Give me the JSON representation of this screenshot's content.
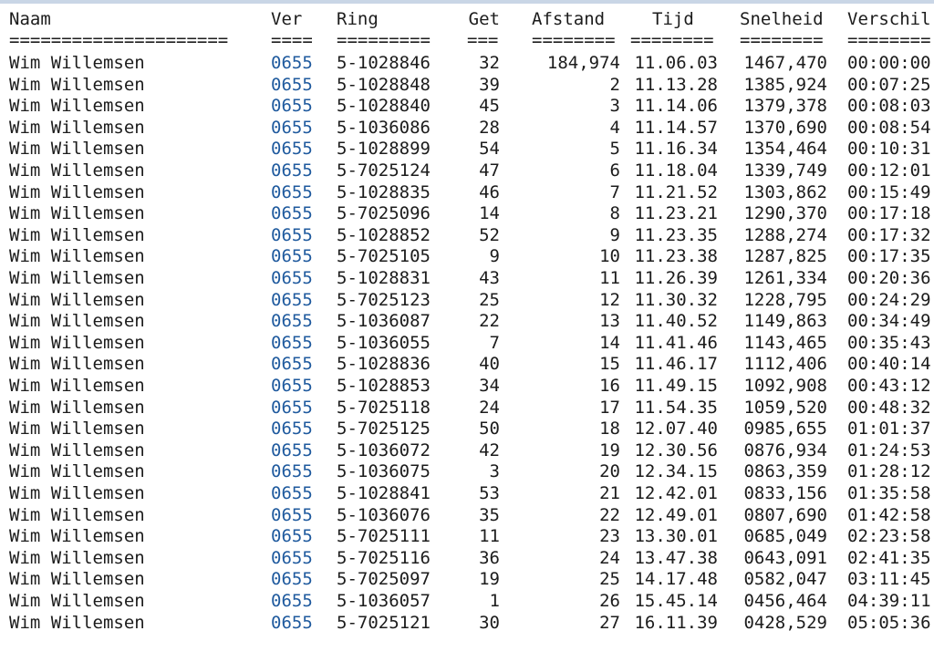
{
  "colors": {
    "text": "#1c1c1c",
    "link": "#1f5a9e",
    "background": "#ffffff"
  },
  "headers": {
    "naam": "Naam",
    "ver": "Ver",
    "ring": "Ring",
    "get": "Get",
    "afstand": "Afstand",
    "tijd": "Tijd",
    "snelheid": "Snelheid",
    "verschil": "Verschil"
  },
  "separators": {
    "naam": "=====================",
    "ver": "====",
    "ring": "=========",
    "get": "===",
    "afstand": "========",
    "tijd": "========",
    "snelheid": "========",
    "verschil": "========"
  },
  "rows": [
    {
      "naam": "Wim Willemsen",
      "ver": "0655",
      "ring": "5-1028846",
      "get": "32",
      "afstand": "184,974",
      "tijd": "11.06.03",
      "snelheid": "1467,470",
      "verschil": "00:00:00"
    },
    {
      "naam": "Wim Willemsen",
      "ver": "0655",
      "ring": "5-1028848",
      "get": "39",
      "afstand": "2",
      "tijd": "11.13.28",
      "snelheid": "1385,924",
      "verschil": "00:07:25"
    },
    {
      "naam": "Wim Willemsen",
      "ver": "0655",
      "ring": "5-1028840",
      "get": "45",
      "afstand": "3",
      "tijd": "11.14.06",
      "snelheid": "1379,378",
      "verschil": "00:08:03"
    },
    {
      "naam": "Wim Willemsen",
      "ver": "0655",
      "ring": "5-1036086",
      "get": "28",
      "afstand": "4",
      "tijd": "11.14.57",
      "snelheid": "1370,690",
      "verschil": "00:08:54"
    },
    {
      "naam": "Wim Willemsen",
      "ver": "0655",
      "ring": "5-1028899",
      "get": "54",
      "afstand": "5",
      "tijd": "11.16.34",
      "snelheid": "1354,464",
      "verschil": "00:10:31"
    },
    {
      "naam": "Wim Willemsen",
      "ver": "0655",
      "ring": "5-7025124",
      "get": "47",
      "afstand": "6",
      "tijd": "11.18.04",
      "snelheid": "1339,749",
      "verschil": "00:12:01"
    },
    {
      "naam": "Wim Willemsen",
      "ver": "0655",
      "ring": "5-1028835",
      "get": "46",
      "afstand": "7",
      "tijd": "11.21.52",
      "snelheid": "1303,862",
      "verschil": "00:15:49"
    },
    {
      "naam": "Wim Willemsen",
      "ver": "0655",
      "ring": "5-7025096",
      "get": "14",
      "afstand": "8",
      "tijd": "11.23.21",
      "snelheid": "1290,370",
      "verschil": "00:17:18"
    },
    {
      "naam": "Wim Willemsen",
      "ver": "0655",
      "ring": "5-1028852",
      "get": "52",
      "afstand": "9",
      "tijd": "11.23.35",
      "snelheid": "1288,274",
      "verschil": "00:17:32"
    },
    {
      "naam": "Wim Willemsen",
      "ver": "0655",
      "ring": "5-7025105",
      "get": "9",
      "afstand": "10",
      "tijd": "11.23.38",
      "snelheid": "1287,825",
      "verschil": "00:17:35"
    },
    {
      "naam": "Wim Willemsen",
      "ver": "0655",
      "ring": "5-1028831",
      "get": "43",
      "afstand": "11",
      "tijd": "11.26.39",
      "snelheid": "1261,334",
      "verschil": "00:20:36"
    },
    {
      "naam": "Wim Willemsen",
      "ver": "0655",
      "ring": "5-7025123",
      "get": "25",
      "afstand": "12",
      "tijd": "11.30.32",
      "snelheid": "1228,795",
      "verschil": "00:24:29"
    },
    {
      "naam": "Wim Willemsen",
      "ver": "0655",
      "ring": "5-1036087",
      "get": "22",
      "afstand": "13",
      "tijd": "11.40.52",
      "snelheid": "1149,863",
      "verschil": "00:34:49"
    },
    {
      "naam": "Wim Willemsen",
      "ver": "0655",
      "ring": "5-1036055",
      "get": "7",
      "afstand": "14",
      "tijd": "11.41.46",
      "snelheid": "1143,465",
      "verschil": "00:35:43"
    },
    {
      "naam": "Wim Willemsen",
      "ver": "0655",
      "ring": "5-1028836",
      "get": "40",
      "afstand": "15",
      "tijd": "11.46.17",
      "snelheid": "1112,406",
      "verschil": "00:40:14"
    },
    {
      "naam": "Wim Willemsen",
      "ver": "0655",
      "ring": "5-1028853",
      "get": "34",
      "afstand": "16",
      "tijd": "11.49.15",
      "snelheid": "1092,908",
      "verschil": "00:43:12"
    },
    {
      "naam": "Wim Willemsen",
      "ver": "0655",
      "ring": "5-7025118",
      "get": "24",
      "afstand": "17",
      "tijd": "11.54.35",
      "snelheid": "1059,520",
      "verschil": "00:48:32"
    },
    {
      "naam": "Wim Willemsen",
      "ver": "0655",
      "ring": "5-7025125",
      "get": "50",
      "afstand": "18",
      "tijd": "12.07.40",
      "snelheid": "0985,655",
      "verschil": "01:01:37"
    },
    {
      "naam": "Wim Willemsen",
      "ver": "0655",
      "ring": "5-1036072",
      "get": "42",
      "afstand": "19",
      "tijd": "12.30.56",
      "snelheid": "0876,934",
      "verschil": "01:24:53"
    },
    {
      "naam": "Wim Willemsen",
      "ver": "0655",
      "ring": "5-1036075",
      "get": "3",
      "afstand": "20",
      "tijd": "12.34.15",
      "snelheid": "0863,359",
      "verschil": "01:28:12"
    },
    {
      "naam": "Wim Willemsen",
      "ver": "0655",
      "ring": "5-1028841",
      "get": "53",
      "afstand": "21",
      "tijd": "12.42.01",
      "snelheid": "0833,156",
      "verschil": "01:35:58"
    },
    {
      "naam": "Wim Willemsen",
      "ver": "0655",
      "ring": "5-1036076",
      "get": "35",
      "afstand": "22",
      "tijd": "12.49.01",
      "snelheid": "0807,690",
      "verschil": "01:42:58"
    },
    {
      "naam": "Wim Willemsen",
      "ver": "0655",
      "ring": "5-7025111",
      "get": "11",
      "afstand": "23",
      "tijd": "13.30.01",
      "snelheid": "0685,049",
      "verschil": "02:23:58"
    },
    {
      "naam": "Wim Willemsen",
      "ver": "0655",
      "ring": "5-7025116",
      "get": "36",
      "afstand": "24",
      "tijd": "13.47.38",
      "snelheid": "0643,091",
      "verschil": "02:41:35"
    },
    {
      "naam": "Wim Willemsen",
      "ver": "0655",
      "ring": "5-7025097",
      "get": "19",
      "afstand": "25",
      "tijd": "14.17.48",
      "snelheid": "0582,047",
      "verschil": "03:11:45"
    },
    {
      "naam": "Wim Willemsen",
      "ver": "0655",
      "ring": "5-1036057",
      "get": "1",
      "afstand": "26",
      "tijd": "15.45.14",
      "snelheid": "0456,464",
      "verschil": "04:39:11"
    },
    {
      "naam": "Wim Willemsen",
      "ver": "0655",
      "ring": "5-7025121",
      "get": "30",
      "afstand": "27",
      "tijd": "16.11.39",
      "snelheid": "0428,529",
      "verschil": "05:05:36"
    }
  ]
}
